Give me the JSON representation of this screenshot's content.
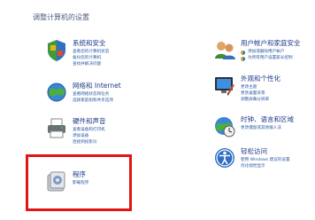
{
  "page": {
    "heading": "调整计算机的设置"
  },
  "categories": [
    {
      "title": "系统和安全",
      "links": [
        "查看您的计算机状态",
        "备份您的计算机",
        "查找并解决问题"
      ]
    },
    {
      "title": "网络和 Internet",
      "links": [
        "查看网络状态和任务",
        "选择家庭组和共享选项"
      ]
    },
    {
      "title": "硬件和声音",
      "links": [
        "查看设备和打印机",
        "添加设备",
        "连接到投影仪"
      ]
    },
    {
      "title": "程序",
      "links": [
        "卸载程序"
      ]
    },
    {
      "title": "用户帐户和家庭安全",
      "links": [
        "添加或删除用户帐户",
        "为所有用户设置家长控制"
      ]
    },
    {
      "title": "外观和个性化",
      "links": [
        "更改主题",
        "更改桌面背景",
        "调整屏幕分辨率"
      ]
    },
    {
      "title": "时钟、语言和区域",
      "links": [
        "更改键盘或其他输入法"
      ]
    },
    {
      "title": "轻松访问",
      "links": [
        "使用 Windows 建议的设置",
        "优化视觉显示"
      ]
    }
  ],
  "colors": {
    "link": "#2d5aa5",
    "title": "#1e3a8a",
    "highlight": "#e01515"
  },
  "icons": [
    "security-icon",
    "network-icon",
    "printer-icon",
    "programs-icon",
    "users-icon",
    "appearance-icon",
    "clock-icon",
    "accessibility-icon"
  ]
}
